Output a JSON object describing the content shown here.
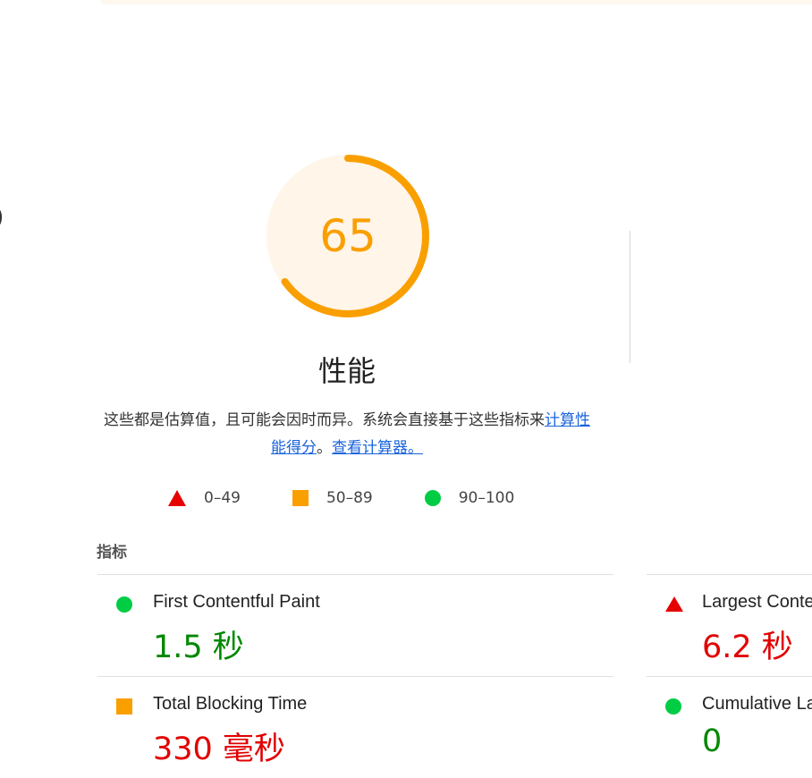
{
  "colors": {
    "average": "#fa9f00",
    "fail": "#e60000",
    "pass": "#00cc44",
    "link": "#1a64dc",
    "gauge_bg": "#fff5e9"
  },
  "performance": {
    "score": "65",
    "score_fraction": 0.65,
    "title": "性能",
    "description_prefix": "这些都是估算值，且可能会因时而异。系统会直接基于这些指标来",
    "calc_link": "计算性能得分",
    "separator": "。",
    "calculator_link": "查看计算器。"
  },
  "legend": [
    {
      "icon": "red-triangle-icon",
      "label": "0–49"
    },
    {
      "icon": "orange-square-icon",
      "label": "50–89"
    },
    {
      "icon": "green-circle-icon",
      "label": "90–100"
    }
  ],
  "metrics_heading": "指标",
  "metrics": [
    {
      "name": "First Contentful Paint",
      "value": "1.5 秒",
      "rating": "pass"
    },
    {
      "name": "Largest Contentful Paint",
      "value": "6.2 秒",
      "rating": "fail"
    },
    {
      "name": "Total Blocking Time",
      "value": "330 毫秒",
      "rating": "average"
    },
    {
      "name": "Cumulative Layout Shift",
      "value": "0",
      "rating": "pass"
    }
  ]
}
